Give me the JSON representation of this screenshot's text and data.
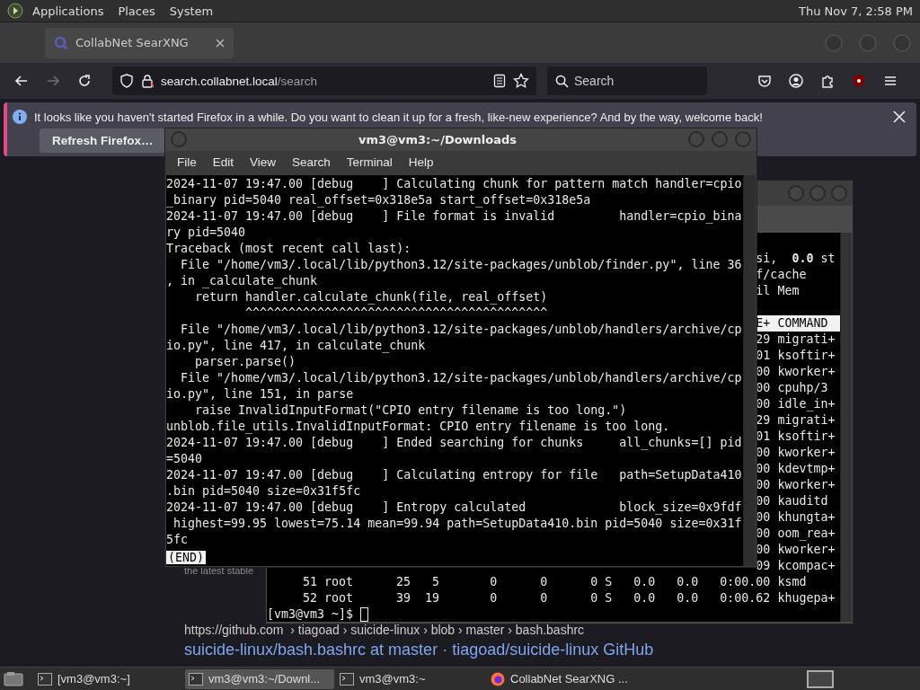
{
  "top_panel": {
    "menus": [
      "Applications",
      "Places",
      "System"
    ],
    "clock": "Thu Nov 7,  2:58 PM"
  },
  "browser": {
    "tabs": [
      {
        "title": "CollabNet SearXNG",
        "selected": true
      }
    ],
    "nav": {
      "forward_disabled": true
    },
    "url": {
      "host": "search.collabnet.local",
      "path": "/search"
    },
    "search": {
      "placeholder": "Search"
    },
    "notification": {
      "message": "It looks like you haven't started Firefox in a while. Do you want to clean it up for a fresh, like-new experience? And by the way, welcome back!",
      "button": "Refresh Firefox…"
    },
    "page": {
      "snippet": "the latest stable",
      "breadcrumb": "https://github.com  › tiagoad › suicide-linux › blob › master › bash.bashrc",
      "result_title": "suicide-linux/bash.bashrc at master · tiagoad/suicide-linux GitHub"
    }
  },
  "background_terminal": {
    "summary_tails": [
      "si,  **0.0** st",
      "f/cache",
      "il Mem"
    ],
    "header_tail": "E+ COMMAND",
    "process_tails": [
      "29 migrati+",
      "01 ksoftir+",
      "00 kworker+",
      "00 cpuhp/3",
      "00 idle_in+",
      "29 migrati+",
      "01 ksoftir+",
      "00 kworker+",
      "00 kdevtmp+",
      "00 kworker+",
      "00 kauditd",
      "00 khungta+",
      "00 oom_rea+",
      "00 kworker+",
      "09 kcompac+"
    ],
    "rows": [
      "     51 root      25   5       0      0      0 S   0.0   0.0   0:00.00 ksmd",
      "     52 root      39  19       0      0      0 S   0.0   0.0   0:00.62 khugepa+"
    ],
    "prompt": "[vm3@vm3 ~]$"
  },
  "foreground_terminal": {
    "title": "vm3@vm3:~/Downloads",
    "menus": [
      "File",
      "Edit",
      "View",
      "Search",
      "Terminal",
      "Help"
    ],
    "lines": [
      "2024-11-07 19:47.00 [debug    ] Calculating chunk for pattern match handler=cpio",
      "_binary pid=5040 real_offset=0x318e5a start_offset=0x318e5a",
      "2024-11-07 19:47.00 [debug    ] File format is invalid         handler=cpio_bina",
      "ry pid=5040",
      "Traceback (most recent call last):",
      "  File \"/home/vm3/.local/lib/python3.12/site-packages/unblob/finder.py\", line 36",
      ", in _calculate_chunk",
      "    return handler.calculate_chunk(file, real_offset)",
      "           ^^^^^^^^^^^^^^^^^^^^^^^^^^^^^^^^^^^^^^^^^^",
      "  File \"/home/vm3/.local/lib/python3.12/site-packages/unblob/handlers/archive/cp",
      "io.py\", line 417, in calculate_chunk",
      "    parser.parse()",
      "  File \"/home/vm3/.local/lib/python3.12/site-packages/unblob/handlers/archive/cp",
      "io.py\", line 151, in parse",
      "    raise InvalidInputFormat(\"CPIO entry filename is too long.\")",
      "unblob.file_utils.InvalidInputFormat: CPIO entry filename is too long.",
      "2024-11-07 19:47.00 [debug    ] Ended searching for chunks     all_chunks=[] pid",
      "=5040",
      "2024-11-07 19:47.00 [debug    ] Calculating entropy for file   path=SetupData410",
      ".bin pid=5040 size=0x31f5fc",
      "2024-11-07 19:47.00 [debug    ] Entropy calculated             block_size=0x9fdf",
      " highest=99.95 lowest=75.14 mean=99.94 path=SetupData410.bin pid=5040 size=0x31f",
      "5fc"
    ],
    "pager_prompt": "(END)"
  },
  "taskbar": {
    "items": [
      {
        "label": "[vm3@vm3:~]",
        "kind": "terminal",
        "selected": false
      },
      {
        "label": "vm3@vm3:~/Downl...",
        "kind": "terminal",
        "selected": true
      },
      {
        "label": "vm3@vm3:~",
        "kind": "terminal",
        "selected": false
      },
      {
        "label": "CollabNet SearXNG ...",
        "kind": "browser",
        "selected": false
      }
    ]
  }
}
